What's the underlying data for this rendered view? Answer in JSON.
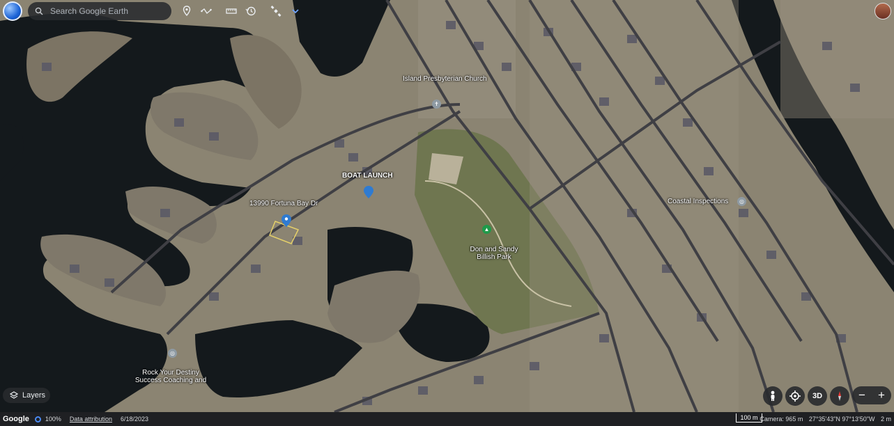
{
  "toolbar": {
    "search_placeholder": "Search Google Earth",
    "icons": [
      "globe-icon",
      "search-icon",
      "pin-icon",
      "path-icon",
      "ruler-icon",
      "history-icon",
      "satellite-icon",
      "chevron-down-icon"
    ]
  },
  "map": {
    "labels": {
      "church": "Island Presbyterian Church",
      "boat_launch": "BOAT LAUNCH",
      "address": "13990 Fortuna Bay Dr",
      "park": "Don and Sandy Billish Park",
      "coastal": "Coastal Inspections",
      "coaching": "Rock Your Destiny Success Coaching and"
    },
    "colors": {
      "water": "#15191b",
      "land": "#8a8370",
      "park": "#6f7650",
      "pin": "#2f7bd1",
      "poi_green": "#1f9a4a",
      "poi_gray": "#8e9aa3"
    }
  },
  "controls": {
    "layers_label": "Layers",
    "view_3d_label": "3D",
    "zoom_out": "−",
    "zoom_in": "+"
  },
  "status": {
    "brand": "Google",
    "zoom": "100%",
    "attribution": "Data attribution",
    "date": "6/18/2023",
    "scale": "100 m",
    "camera": "Camera: 965 m",
    "coords": "27°35'43\"N 97°13'50\"W",
    "elevation": "2 m"
  }
}
